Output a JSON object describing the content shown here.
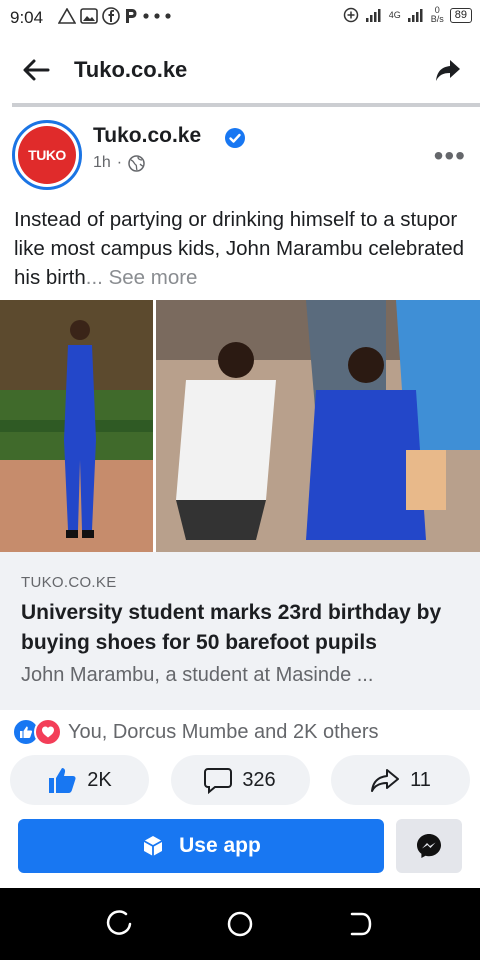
{
  "status_bar": {
    "time": "9:04",
    "network_type": "4G",
    "speed_value": "0",
    "speed_unit": "B/s",
    "battery": "89"
  },
  "top_bar": {
    "title": "Tuko.co.ke"
  },
  "post": {
    "page_name": "Tuko.co.ke",
    "avatar_text": "TUKO",
    "time": "1h",
    "separator": "·",
    "text": "Instead of partying or drinking himself to a stupor like most campus kids, John Marambu celebrated his birth",
    "ellipsis": "...",
    "see_more": "See more"
  },
  "link_card": {
    "domain": "TUKO.CO.KE",
    "title": "University student marks 23rd birthday by buying shoes for 50 barefoot pupils",
    "description": "John Marambu, a student at Masinde ..."
  },
  "reactions": {
    "summary": "You, Dorcus Mumbe and 2K others"
  },
  "actions": {
    "likes": "2K",
    "comments": "326",
    "shares": "11"
  },
  "cta": {
    "use_app_label": "Use app"
  },
  "colors": {
    "brand_blue": "#1877f2",
    "tuko_red": "#e02b2b"
  }
}
